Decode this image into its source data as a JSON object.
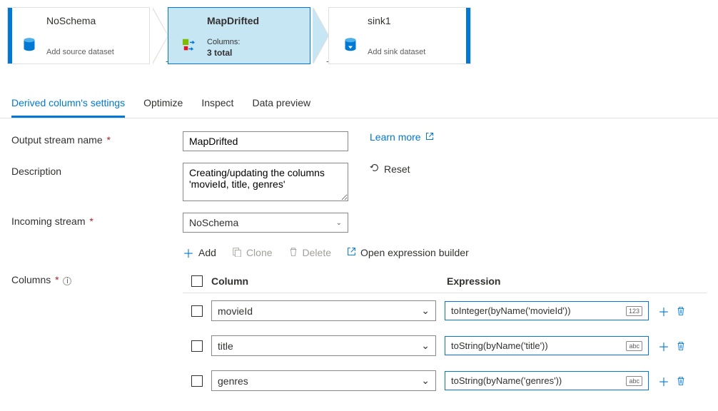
{
  "nodes": {
    "source": {
      "title": "NoSchema",
      "subtitle": "Add source dataset"
    },
    "transform": {
      "title": "MapDrifted",
      "columns_label": "Columns:",
      "columns_value": "3 total"
    },
    "sink": {
      "title": "sink1",
      "subtitle": "Add sink dataset"
    }
  },
  "tabs": {
    "settings": "Derived column's settings",
    "optimize": "Optimize",
    "inspect": "Inspect",
    "preview": "Data preview"
  },
  "form": {
    "stream_label": "Output stream name",
    "stream_value": "MapDrifted",
    "desc_label": "Description",
    "desc_value": "Creating/updating the columns 'movieId, title, genres'",
    "incoming_label": "Incoming stream",
    "incoming_value": "NoSchema",
    "learn_more": "Learn more",
    "reset": "Reset",
    "columns_label": "Columns"
  },
  "toolbar": {
    "add": "Add",
    "clone": "Clone",
    "delete": "Delete",
    "open_expr": "Open expression builder"
  },
  "table": {
    "col_header": "Column",
    "expr_header": "Expression",
    "rows": [
      {
        "col": "movieId",
        "expr": "toInteger(byName('movieId'))",
        "badge": "123"
      },
      {
        "col": "title",
        "expr": "toString(byName('title'))",
        "badge": "abc"
      },
      {
        "col": "genres",
        "expr": "toString(byName('genres'))",
        "badge": "abc"
      }
    ]
  }
}
